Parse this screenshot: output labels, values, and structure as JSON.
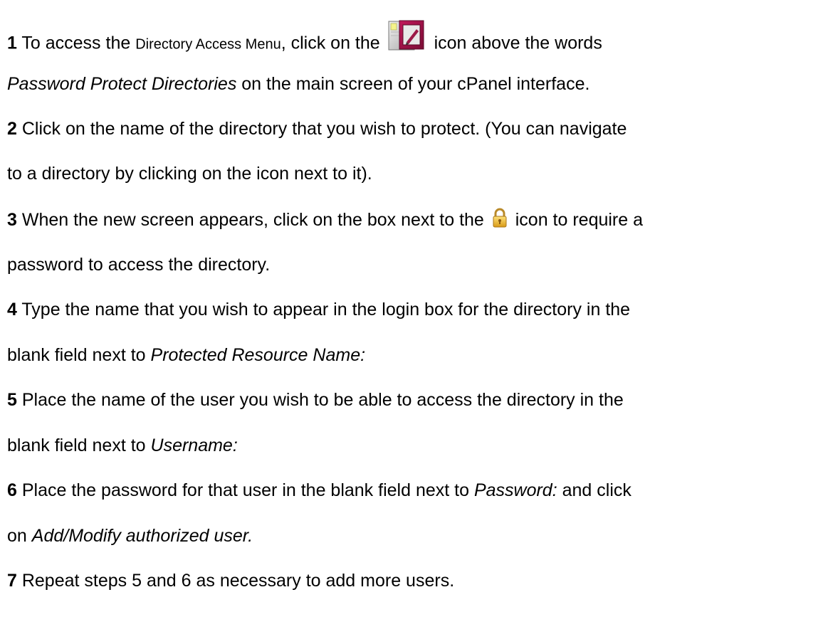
{
  "steps": [
    {
      "number": "1",
      "text_a": " To access the ",
      "text_a_small": "Directory Access Menu",
      "text_b": ", click on the ",
      "text_c": " icon above the words",
      "line2_italic": "Password Protect Directories",
      "line2_text": " on the main screen of your cPanel interface."
    },
    {
      "number": "2",
      "line1": " Click on the name of the directory that you wish to protect. (You can navigate",
      "line2": "to a directory by clicking on the icon next to it)."
    },
    {
      "number": "3",
      "text_a": " When the new screen appears, click on the box next to the ",
      "text_b": " icon to require a",
      "line2": "password to access the directory."
    },
    {
      "number": "4",
      "line1": " Type the name that you wish to appear in the login box for the directory in the",
      "line2_text": "blank field next to ",
      "line2_italic": "Protected Resource Name:"
    },
    {
      "number": "5",
      "line1": " Place the name of the user you wish to be able to access the directory in the",
      "line2_text": "blank field next to ",
      "line2_italic": "Username:"
    },
    {
      "number": "6",
      "line1_text": " Place the password for that user in the blank field next to ",
      "line1_italic": "Password:",
      "line1_tail": " and click",
      "line2_text": "on ",
      "line2_italic": "Add/Modify authorized user."
    },
    {
      "number": "7",
      "line1": " Repeat steps 5 and 6 as necessary to add more users."
    }
  ],
  "icons": {
    "directory_access": "password-protect-directories-icon",
    "lock": "lock-icon"
  }
}
